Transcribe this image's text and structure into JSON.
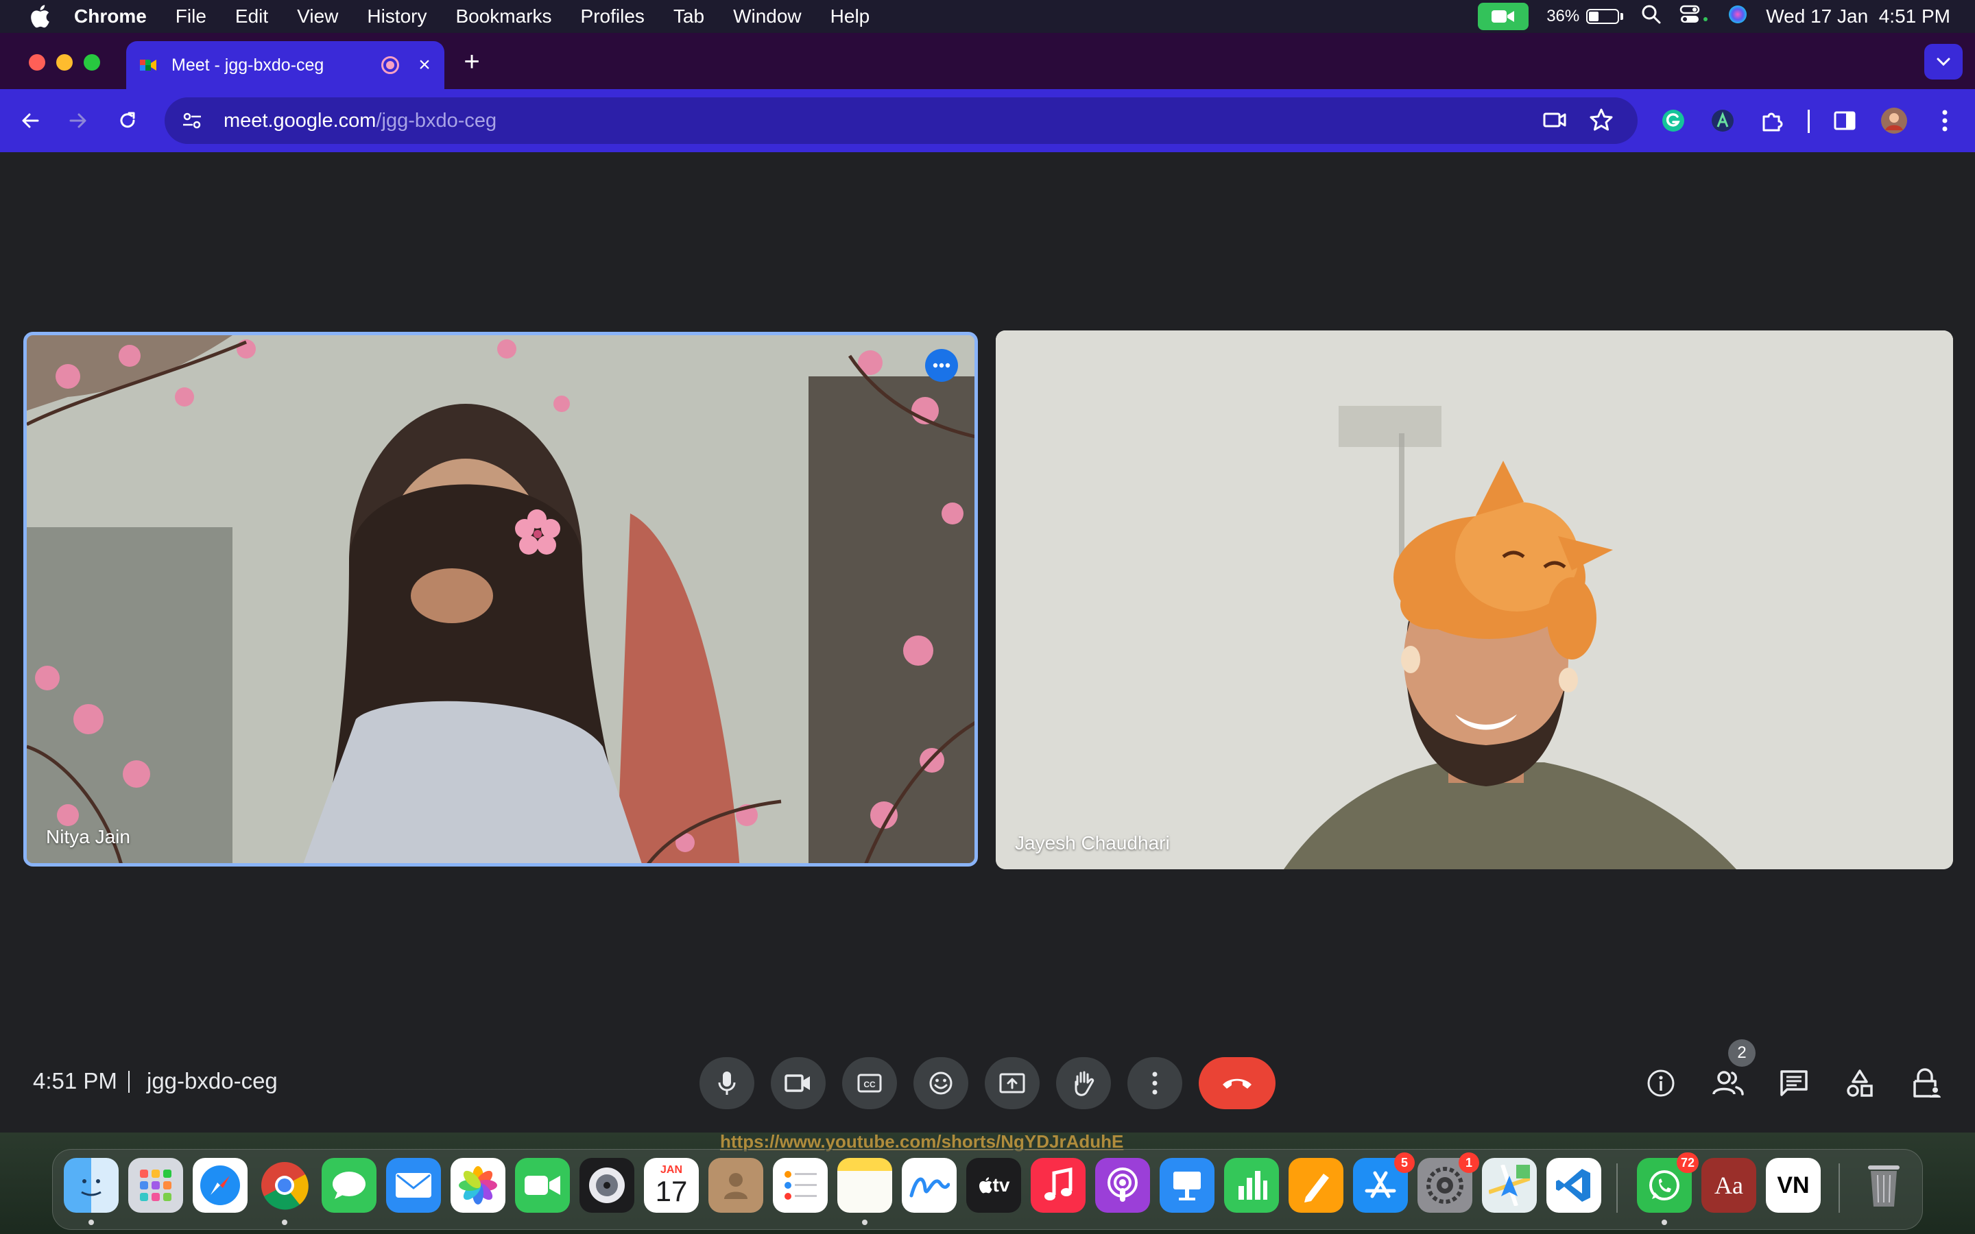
{
  "menubar": {
    "app_name": "Chrome",
    "menus": [
      "File",
      "Edit",
      "View",
      "History",
      "Bookmarks",
      "Profiles",
      "Tab",
      "Window",
      "Help"
    ],
    "battery_percent": "36%",
    "battery_level": 0.36,
    "datetime": "Wed 17 Jan  4:51 PM"
  },
  "browser": {
    "tab_title": "Meet - jgg-bxdo-ceg",
    "url_host": "meet.google.com",
    "url_path": "/jgg-bxdo-ceg"
  },
  "meet": {
    "participants": [
      {
        "name": "Nitya Jain"
      },
      {
        "name": "Jayesh Chaudhari"
      }
    ],
    "time": "4:51 PM",
    "meeting_code": "jgg-bxdo-ceg",
    "people_count": "2"
  },
  "desktop": {
    "link_text": "https://www.youtube.com/shorts/NgYDJrAduhE"
  },
  "dock": {
    "calendar_month": "JAN",
    "calendar_day": "17",
    "appletv_label": "tv",
    "dictionary_label": "Aa",
    "vn_label": "VN",
    "appstore_badge": "5",
    "settings_badge": "1",
    "whatsapp_badge": "72"
  },
  "colors": {
    "tab_active": "#3a2ad8",
    "tabstrip": "#2a0a3a",
    "meet_bg": "#202124",
    "leave_button": "#ea4335",
    "active_speaker_border": "#8ab4f8",
    "camera_indicator": "#33c25a"
  }
}
